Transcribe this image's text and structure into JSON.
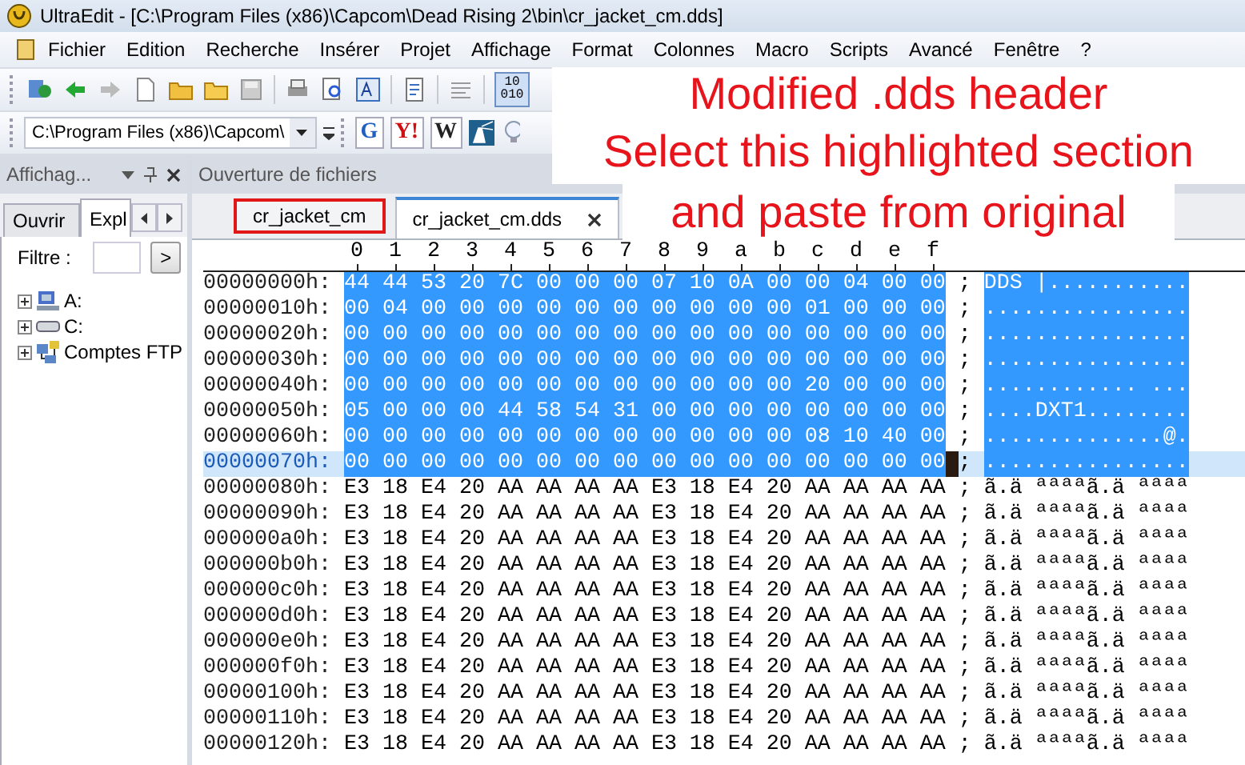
{
  "window": {
    "title": "UltraEdit - [C:\\Program Files (x86)\\Capcom\\Dead Rising 2\\bin\\cr_jacket_cm.dds]"
  },
  "menu": [
    "Fichier",
    "Edition",
    "Recherche",
    "Insérer",
    "Projet",
    "Affichage",
    "Format",
    "Colonnes",
    "Macro",
    "Scripts",
    "Avancé",
    "Fenêtre",
    "?"
  ],
  "toolbar": {
    "hex_button": {
      "label": "10 010",
      "pressed": true
    }
  },
  "path_bar": {
    "value": "C:\\Program Files (x86)\\Capcom\\",
    "search_buttons": [
      {
        "label": "G",
        "color": "#1f5fbf"
      },
      {
        "label": "Y!",
        "color": "#d01010"
      },
      {
        "label": "W",
        "color": "#222222"
      }
    ]
  },
  "side_panel": {
    "title": "Affichag...",
    "tabs": [
      {
        "label": "Ouvrir",
        "selected": false
      },
      {
        "label": "Expl",
        "selected": true
      }
    ],
    "filter": {
      "label": "Filtre :",
      "button": ">"
    },
    "tree": [
      {
        "label": "A:",
        "kind": "floppy",
        "expanded": false
      },
      {
        "label": "C:",
        "kind": "drive",
        "expanded": false
      },
      {
        "label": "Comptes FTP",
        "kind": "network",
        "expanded": false
      }
    ]
  },
  "editor": {
    "title": "Ouverture de fichiers",
    "tabs": [
      {
        "label": "cr_jacket_cm",
        "selected": false,
        "annotated": true
      },
      {
        "label": "cr_jacket_cm.dds",
        "selected": true,
        "annotated": false
      }
    ],
    "ruler": [
      "0",
      "1",
      "2",
      "3",
      "4",
      "5",
      "6",
      "7",
      "8",
      "9",
      "a",
      "b",
      "c",
      "d",
      "e",
      "f"
    ],
    "rows": [
      {
        "address": "00000000h:",
        "hex": "44 44 53 20 7C 00 00 00 07 10 0A 00 00 04 00 00",
        "separator": ";",
        "ascii": "DDS |...........",
        "selected": true,
        "current": false
      },
      {
        "address": "00000010h:",
        "hex": "00 04 00 00 00 00 00 00 00 00 00 00 01 00 00 00",
        "separator": ";",
        "ascii": "................",
        "selected": true,
        "current": false
      },
      {
        "address": "00000020h:",
        "hex": "00 00 00 00 00 00 00 00 00 00 00 00 00 00 00 00",
        "separator": ";",
        "ascii": "................",
        "selected": true,
        "current": false
      },
      {
        "address": "00000030h:",
        "hex": "00 00 00 00 00 00 00 00 00 00 00 00 00 00 00 00",
        "separator": ";",
        "ascii": "................",
        "selected": true,
        "current": false
      },
      {
        "address": "00000040h:",
        "hex": "00 00 00 00 00 00 00 00 00 00 00 00 20 00 00 00",
        "separator": ";",
        "ascii": "............ ...",
        "selected": true,
        "current": false
      },
      {
        "address": "00000050h:",
        "hex": "05 00 00 00 44 58 54 31 00 00 00 00 00 00 00 00",
        "separator": ";",
        "ascii": "....DXT1........",
        "selected": true,
        "current": false
      },
      {
        "address": "00000060h:",
        "hex": "00 00 00 00 00 00 00 00 00 00 00 00 08 10 40 00",
        "separator": ";",
        "ascii": "..............@.",
        "selected": true,
        "current": false
      },
      {
        "address": "00000070h:",
        "hex": "00 00 00 00 00 00 00 00 00 00 00 00 00 00 00 00",
        "separator": ";",
        "ascii": "................",
        "selected": true,
        "current": true
      },
      {
        "address": "00000080h:",
        "hex": "E3 18 E4 20 AA AA AA AA E3 18 E4 20 AA AA AA AA",
        "separator": ";",
        "ascii": "ã.ä ªªªªã.ä ªªªª",
        "selected": false,
        "current": false
      },
      {
        "address": "00000090h:",
        "hex": "E3 18 E4 20 AA AA AA AA E3 18 E4 20 AA AA AA AA",
        "separator": ";",
        "ascii": "ã.ä ªªªªã.ä ªªªª",
        "selected": false,
        "current": false
      },
      {
        "address": "000000a0h:",
        "hex": "E3 18 E4 20 AA AA AA AA E3 18 E4 20 AA AA AA AA",
        "separator": ";",
        "ascii": "ã.ä ªªªªã.ä ªªªª",
        "selected": false,
        "current": false
      },
      {
        "address": "000000b0h:",
        "hex": "E3 18 E4 20 AA AA AA AA E3 18 E4 20 AA AA AA AA",
        "separator": ";",
        "ascii": "ã.ä ªªªªã.ä ªªªª",
        "selected": false,
        "current": false
      },
      {
        "address": "000000c0h:",
        "hex": "E3 18 E4 20 AA AA AA AA E3 18 E4 20 AA AA AA AA",
        "separator": ";",
        "ascii": "ã.ä ªªªªã.ä ªªªª",
        "selected": false,
        "current": false
      },
      {
        "address": "000000d0h:",
        "hex": "E3 18 E4 20 AA AA AA AA E3 18 E4 20 AA AA AA AA",
        "separator": ";",
        "ascii": "ã.ä ªªªªã.ä ªªªª",
        "selected": false,
        "current": false
      },
      {
        "address": "000000e0h:",
        "hex": "E3 18 E4 20 AA AA AA AA E3 18 E4 20 AA AA AA AA",
        "separator": ";",
        "ascii": "ã.ä ªªªªã.ä ªªªª",
        "selected": false,
        "current": false
      },
      {
        "address": "000000f0h:",
        "hex": "E3 18 E4 20 AA AA AA AA E3 18 E4 20 AA AA AA AA",
        "separator": ";",
        "ascii": "ã.ä ªªªªã.ä ªªªª",
        "selected": false,
        "current": false
      },
      {
        "address": "00000100h:",
        "hex": "E3 18 E4 20 AA AA AA AA E3 18 E4 20 AA AA AA AA",
        "separator": ";",
        "ascii": "ã.ä ªªªªã.ä ªªªª",
        "selected": false,
        "current": false
      },
      {
        "address": "00000110h:",
        "hex": "E3 18 E4 20 AA AA AA AA E3 18 E4 20 AA AA AA AA",
        "separator": ";",
        "ascii": "ã.ä ªªªªã.ä ªªªª",
        "selected": false,
        "current": false
      },
      {
        "address": "00000120h:",
        "hex": "E3 18 E4 20 AA AA AA AA E3 18 E4 20 AA AA AA AA",
        "separator": ";",
        "ascii": "ã.ä ªªªªã.ä ªªªª",
        "selected": false,
        "current": false
      }
    ]
  },
  "annotation": {
    "lines": [
      "Modified .dds header",
      "Select this highlighted section",
      "and paste from original"
    ]
  }
}
